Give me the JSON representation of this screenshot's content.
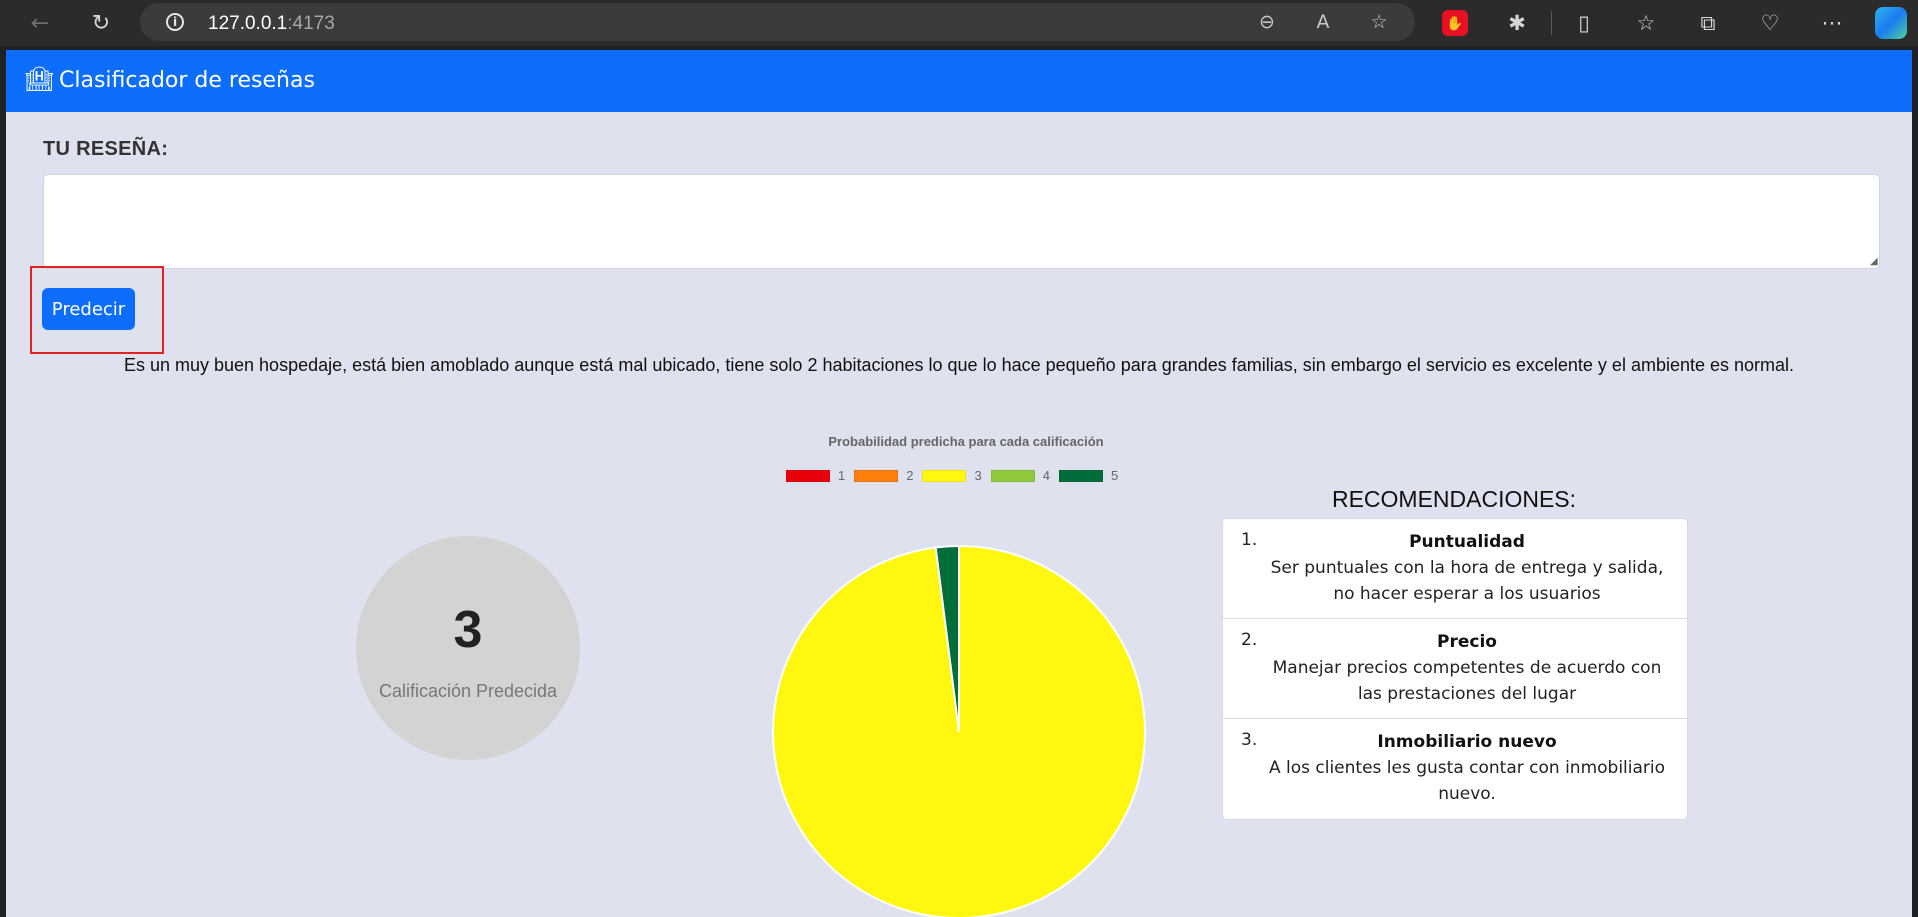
{
  "browser": {
    "url_host": "127.0.0.1",
    "url_port": ":4173"
  },
  "app": {
    "title": "Clasificador de reseñas",
    "brand_icon": "hotel-icon"
  },
  "review": {
    "label": "TU RESEÑA:",
    "input_value": "",
    "submit_label": "Predecir",
    "submitted_text": "Es un muy buen hospedaje, está bien amoblado aunque está mal ubicado, tiene solo 2 habitaciones lo que lo hace pequeño para grandes familias, sin embargo el servicio es excelente y el ambiente es normal."
  },
  "prediction": {
    "value": "3",
    "label": "Calificación Predecida"
  },
  "chart_data": {
    "type": "pie",
    "title": "Probabilidad predicha para cada calificación",
    "categories": [
      "1",
      "2",
      "3",
      "4",
      "5"
    ],
    "values": [
      0.0,
      0.0,
      0.98,
      0.0,
      0.02
    ],
    "colors": [
      "#e8000b",
      "#ff7f0e",
      "#fff70f",
      "#8fc93a",
      "#006d3b"
    ],
    "legend_position": "top"
  },
  "recommendations": {
    "title": "RECOMENDACIONES:",
    "items": [
      {
        "num": "1.",
        "name": "Puntualidad",
        "desc": "Ser puntuales con la hora de entrega y salida, no hacer esperar a los usuarios"
      },
      {
        "num": "2.",
        "name": "Precio",
        "desc": "Manejar precios competentes de acuerdo con las prestaciones del lugar"
      },
      {
        "num": "3.",
        "name": "Inmobiliario nuevo",
        "desc": "A los clientes les gusta contar con inmobiliario nuevo."
      }
    ]
  }
}
